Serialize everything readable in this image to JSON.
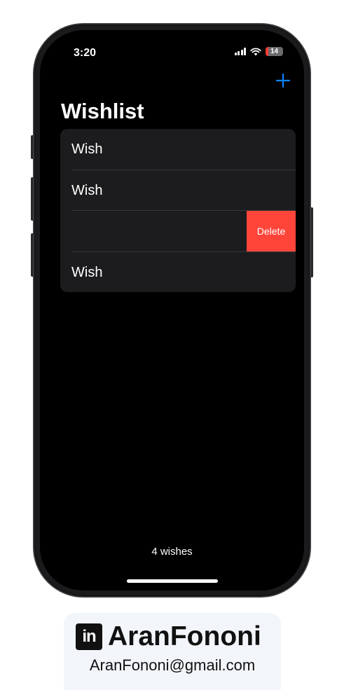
{
  "status_bar": {
    "time": "3:20",
    "battery_level": "14",
    "battery_color": "#ff3b30"
  },
  "nav": {
    "add_icon": "plus-icon",
    "accent_color": "#0a84ff"
  },
  "page": {
    "title": "Wishlist"
  },
  "list": {
    "rows": [
      {
        "label": "Wish"
      },
      {
        "label": "Wish"
      },
      {
        "label": "",
        "swipe_action": "Delete"
      },
      {
        "label": "Wish"
      }
    ],
    "delete_color": "#ff453a"
  },
  "footer": {
    "count_text": "4 wishes"
  },
  "branding": {
    "icon": "linkedin-icon",
    "icon_text": "in",
    "name": "AranFononi",
    "email": "AranFononi@gmail.com"
  }
}
